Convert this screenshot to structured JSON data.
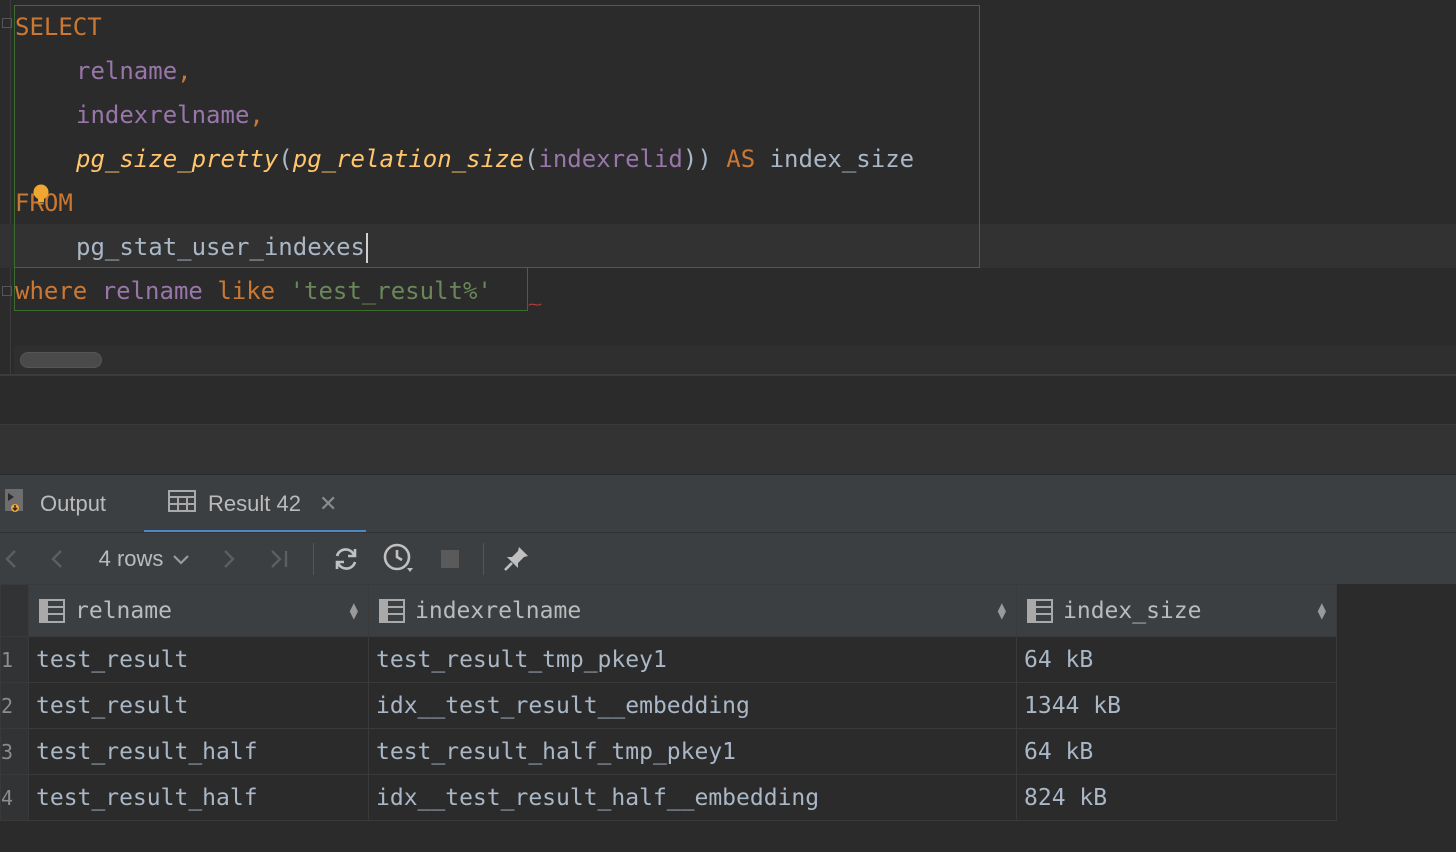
{
  "editor": {
    "lines": [
      {
        "segments": [
          {
            "text": "SELECT",
            "cls": "kw"
          }
        ]
      },
      {
        "indent": true,
        "segments": [
          {
            "text": "relname",
            "cls": "col"
          },
          {
            "text": ",",
            "cls": "kw"
          }
        ]
      },
      {
        "indent": true,
        "segments": [
          {
            "text": "indexrelname",
            "cls": "col"
          },
          {
            "text": ",",
            "cls": "kw"
          }
        ]
      },
      {
        "indent": true,
        "segments": [
          {
            "text": "pg_size_pretty",
            "cls": "fn"
          },
          {
            "text": "(",
            "cls": "plain"
          },
          {
            "text": "pg_relation_size",
            "cls": "fn"
          },
          {
            "text": "(",
            "cls": "plain"
          },
          {
            "text": "indexrelid",
            "cls": "col"
          },
          {
            "text": ")) ",
            "cls": "plain"
          },
          {
            "text": "AS",
            "cls": "kw"
          },
          {
            "text": " index_size",
            "cls": "plain"
          }
        ]
      },
      {
        "segments": [
          {
            "text": "FROM",
            "cls": "kw"
          }
        ]
      },
      {
        "indent": true,
        "caret": true,
        "segments": [
          {
            "text": "pg_stat_user_indexes",
            "cls": "plain"
          }
        ]
      },
      {
        "segments": [
          {
            "text": "where",
            "cls": "kw"
          },
          {
            "text": " ",
            "cls": "plain"
          },
          {
            "text": "relname",
            "cls": "col"
          },
          {
            "text": " ",
            "cls": "plain"
          },
          {
            "text": "like",
            "cls": "kw"
          },
          {
            "text": " ",
            "cls": "plain"
          },
          {
            "text": "'test_result%'",
            "cls": "str"
          }
        ]
      }
    ]
  },
  "tabs": {
    "output_label": "Output",
    "result_label": "Result 42"
  },
  "toolbar": {
    "rows_label": "4 rows"
  },
  "grid": {
    "columns": [
      "relname",
      "indexrelname",
      "index_size"
    ],
    "rows": [
      {
        "num": "1",
        "cells": [
          "test_result",
          "test_result_tmp_pkey1",
          "64 kB"
        ]
      },
      {
        "num": "2",
        "cells": [
          "test_result",
          "idx__test_result__embedding",
          "1344 kB"
        ]
      },
      {
        "num": "3",
        "cells": [
          "test_result_half",
          "test_result_half_tmp_pkey1",
          "64 kB"
        ]
      },
      {
        "num": "4",
        "cells": [
          "test_result_half",
          "idx__test_result_half__embedding",
          "824 kB"
        ]
      }
    ]
  },
  "colors": {
    "background": "#2b2b2b",
    "keyword": "#cc7832",
    "column": "#9876aa",
    "function": "#ffc66d",
    "string": "#6a8759",
    "selection_border": "#3b6e2e",
    "tab_underline": "#4a88c7"
  },
  "icons": {
    "output": "output-console-icon",
    "result": "table-grid-icon",
    "close": "close-icon",
    "first": "chevron-left-icon",
    "prev": "arrow-left-icon",
    "next": "arrow-right-icon",
    "last": "last-page-icon",
    "refresh": "refresh-icon",
    "history": "history-clock-icon",
    "stop": "stop-icon",
    "pin": "pin-icon",
    "column": "column-icon",
    "sort": "sort-icon",
    "bulb": "intention-bulb-icon"
  }
}
